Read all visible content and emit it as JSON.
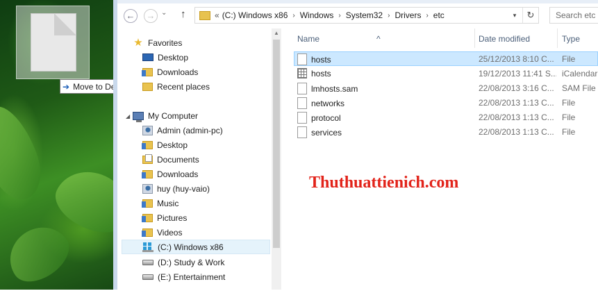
{
  "desktop": {
    "drag_tooltip": "Move to Desktop"
  },
  "toolbar": {
    "back_label": "←",
    "forward_label": "→",
    "up_label": "↑"
  },
  "address_bar": {
    "prefix": "«",
    "crumbs": [
      "(C:) Windows x86",
      "Windows",
      "System32",
      "Drivers",
      "etc"
    ]
  },
  "search": {
    "placeholder": "Search etc"
  },
  "nav_pane": {
    "favorites": {
      "label": "Favorites",
      "items": [
        "Desktop",
        "Downloads",
        "Recent places"
      ]
    },
    "computer": {
      "label": "My Computer",
      "items": [
        "Admin (admin-pc)",
        "Desktop",
        "Documents",
        "Downloads",
        "huy (huy-vaio)",
        "Music",
        "Pictures",
        "Videos",
        "(C:) Windows x86",
        "(D:) Study & Work",
        "(E:) Entertainment"
      ]
    },
    "selected_item": "(C:) Windows x86"
  },
  "file_list": {
    "columns": [
      "Name",
      "Date modified",
      "Type"
    ],
    "rows": [
      {
        "name": "hosts",
        "date": "25/12/2013 8:10 C...",
        "type": "File",
        "icon": "file-icon",
        "selected": true
      },
      {
        "name": "hosts",
        "date": "19/12/2013 11:41 S...",
        "type": "iCalendar F",
        "icon": "calendar-file-icon",
        "selected": false
      },
      {
        "name": "lmhosts.sam",
        "date": "22/08/2013 3:16 C...",
        "type": "SAM File",
        "icon": "file-icon",
        "selected": false
      },
      {
        "name": "networks",
        "date": "22/08/2013 1:13 C...",
        "type": "File",
        "icon": "file-icon",
        "selected": false
      },
      {
        "name": "protocol",
        "date": "22/08/2013 1:13 C...",
        "type": "File",
        "icon": "file-icon",
        "selected": false
      },
      {
        "name": "services",
        "date": "22/08/2013 1:13 C...",
        "type": "File",
        "icon": "file-icon",
        "selected": false
      }
    ]
  },
  "watermark": "Thuthuattienich.com",
  "colors": {
    "selection_bg": "#cce8ff",
    "nav_selection_bg": "#e5f3fb",
    "watermark": "#e2231a",
    "column_header": "#4c607a"
  }
}
